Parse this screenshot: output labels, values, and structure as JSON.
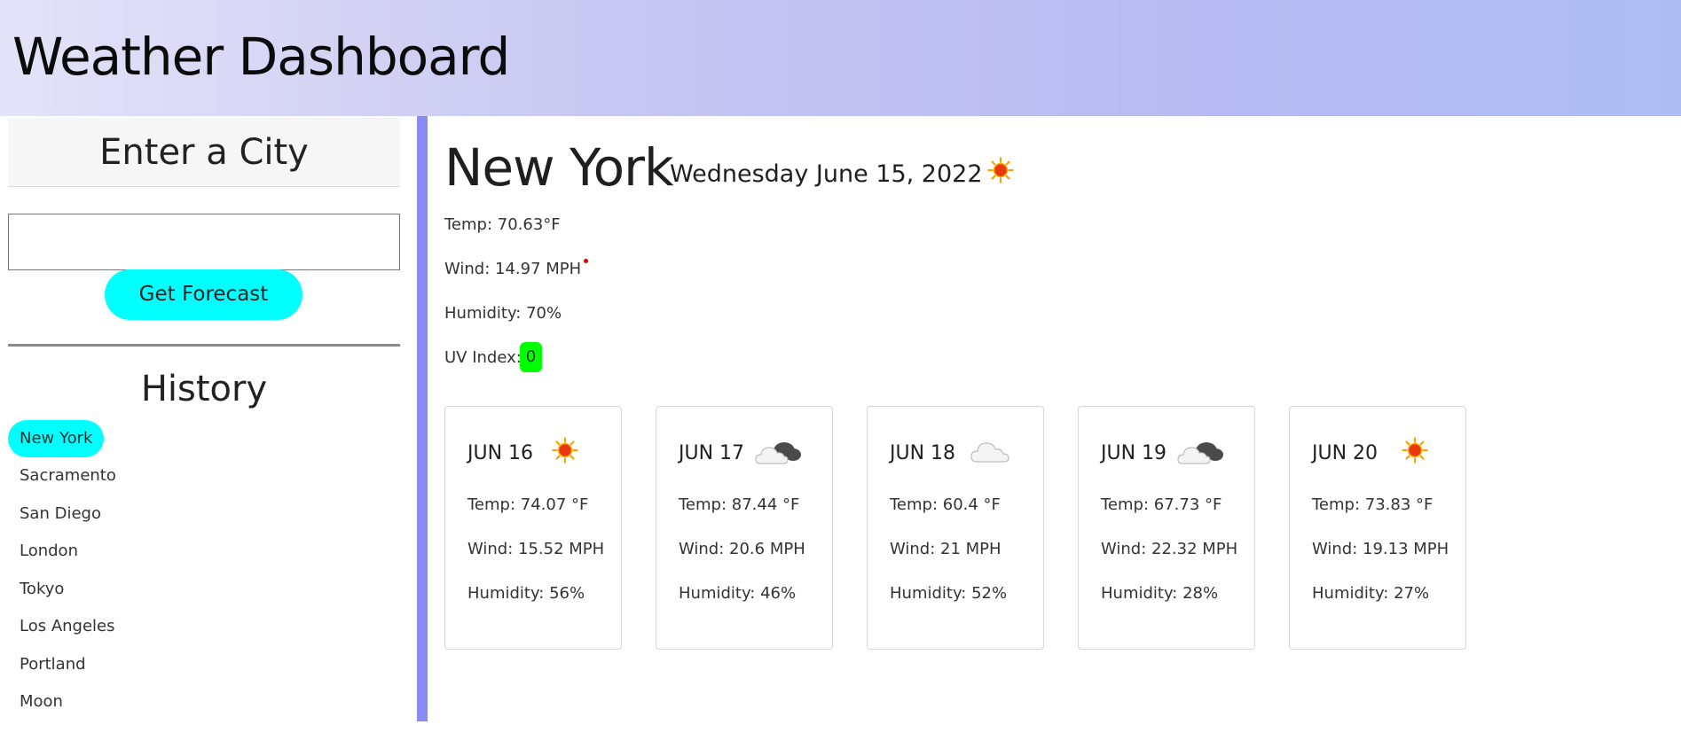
{
  "header": {
    "title": "Weather Dashboard"
  },
  "sidebar": {
    "enter_title": "Enter a City",
    "search": {
      "value": "",
      "placeholder": ""
    },
    "forecast_button": "Get Forecast",
    "history_title": "History",
    "history": [
      "New York",
      "Sacramento",
      "San Diego",
      "London",
      "Tokyo",
      "Los Angeles",
      "Portland",
      "Moon"
    ],
    "active_history": "New York"
  },
  "current": {
    "city": "New York",
    "date": "Wednesday June 15, 2022",
    "icon": "sun-icon",
    "temp": "Temp: 70.63°F",
    "wind": "Wind: 14.97 MPH",
    "humidity": "Humidity: 70%",
    "uv_label": "UV Index:",
    "uv_value": "0",
    "uv_color": "#00ff00"
  },
  "forecast": [
    {
      "date": "JUN 16",
      "icon": "sun-icon",
      "temp": "Temp: 74.07 °F",
      "wind": "Wind: 15.52 MPH",
      "humidity": "Humidity: 56%"
    },
    {
      "date": "JUN 17",
      "icon": "cloudy-icon",
      "temp": "Temp: 87.44 °F",
      "wind": "Wind: 20.6 MPH",
      "humidity": "Humidity: 46%"
    },
    {
      "date": "JUN 18",
      "icon": "cloud-icon",
      "temp": "Temp: 60.4 °F",
      "wind": "Wind: 21 MPH",
      "humidity": "Humidity: 52%"
    },
    {
      "date": "JUN 19",
      "icon": "cloudy-icon",
      "temp": "Temp: 67.73 °F",
      "wind": "Wind: 22.32 MPH",
      "humidity": "Humidity: 28%"
    },
    {
      "date": "JUN 20",
      "icon": "sun-icon",
      "temp": "Temp: 73.83 °F",
      "wind": "Wind: 19.13 MPH",
      "humidity": "Humidity: 27%"
    }
  ],
  "colors": {
    "accent": "#00ffff",
    "divider_bar": "#8a8cf5",
    "uv_good": "#00ff00"
  }
}
